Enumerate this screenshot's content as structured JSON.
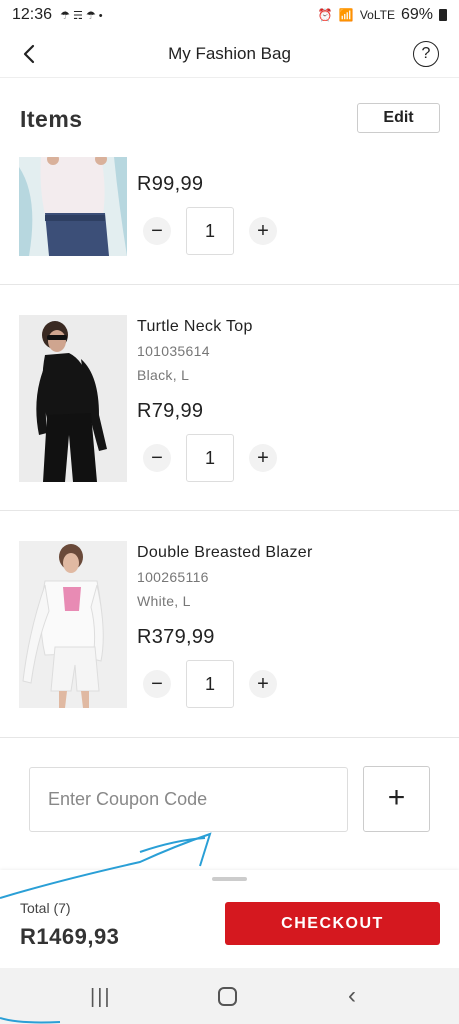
{
  "status_bar": {
    "time": "12:36",
    "notifications": "☂ ☴ ☂ •",
    "network": "VoLTE",
    "battery": "69%"
  },
  "header": {
    "title": "My Fashion Bag"
  },
  "items_section": {
    "heading": "Items",
    "edit_label": "Edit"
  },
  "products": [
    {
      "name": "",
      "sku": "",
      "variant": "",
      "price": "R99,99",
      "quantity": "1"
    },
    {
      "name": "Turtle Neck Top",
      "sku": "101035614",
      "variant": "Black, L",
      "price": "R79,99",
      "quantity": "1"
    },
    {
      "name": "Double Breasted Blazer",
      "sku": "100265116",
      "variant": "White, L",
      "price": "R379,99",
      "quantity": "1"
    }
  ],
  "qty_controls": {
    "minus": "−",
    "plus": "+"
  },
  "coupon": {
    "placeholder": "Enter Coupon Code",
    "add_label": "+"
  },
  "footer": {
    "total_label": "Total (7)",
    "total_amount": "R1469,93",
    "checkout_label": "CHECKOUT"
  },
  "colors": {
    "accent": "#d5181f",
    "ink": "#2a9fd6"
  },
  "icons": {
    "back": "chevron-left-icon",
    "help": "question-circle-icon"
  }
}
